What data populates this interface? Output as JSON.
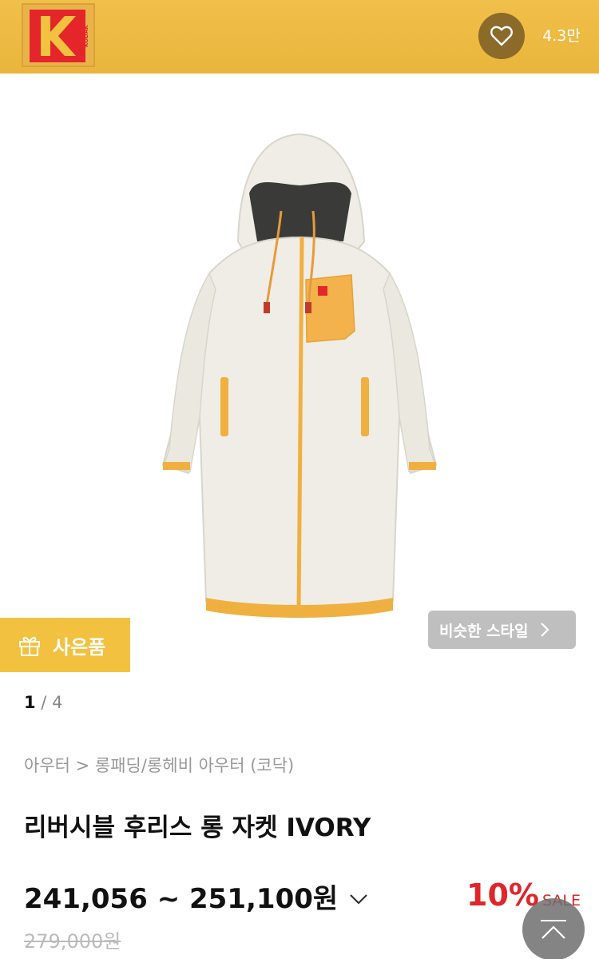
{
  "header": {
    "brand_logo_text": "KODAK",
    "likes_count": "4.3만"
  },
  "gallery": {
    "current": "1",
    "separator": " / ",
    "total": "4",
    "gift_label": "사은품",
    "similar_label": "비슷한 스타일"
  },
  "product": {
    "breadcrumb": "아우터 > 롱패딩/롱헤비 아우터 (코닥)",
    "title": "리버시블 후리스 롱 자켓 IVORY",
    "price_range": "241,056 ~ 251,100원",
    "discount": "10%",
    "sale_label": "SALE",
    "original_price": "279,000원"
  },
  "colors": {
    "header": "#f1c04a",
    "accent_red": "#e0252b",
    "gift_badge": "#f2c13f",
    "jacket_body": "#efede6",
    "jacket_trim": "#f0b040"
  },
  "icons": {
    "heart": "heart-icon",
    "gift": "gift-icon",
    "chevron_right": "chevron-right-icon",
    "chevron_down": "chevron-down-icon",
    "scroll_top": "chevron-up-icon"
  }
}
